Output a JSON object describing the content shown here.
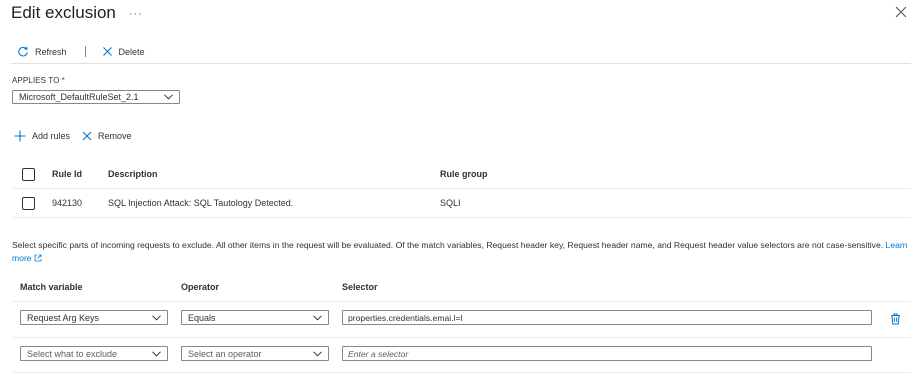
{
  "header": {
    "title": "Edit exclusion",
    "more_label": "···"
  },
  "toolbar": {
    "refresh_label": "Refresh",
    "delete_label": "Delete"
  },
  "applies_to": {
    "label": "APPLIES TO",
    "required_mark": "*",
    "selected": "Microsoft_DefaultRuleSet_2.1"
  },
  "rules_bar": {
    "add_label": "Add rules",
    "remove_label": "Remove"
  },
  "rules_table": {
    "columns": [
      "Rule Id",
      "Description",
      "Rule group"
    ],
    "rows": [
      {
        "rule_id": "942130",
        "description": "SQL Injection Attack: SQL Tautology Detected.",
        "rule_group": "SQLI"
      }
    ]
  },
  "info": {
    "text": "Select specific parts of incoming requests to exclude. All other items in the request will be evaluated. Of the match variables, Request header key, Request header name, and Request header value selectors are not case-sensitive.",
    "learn_more_label": "Learn more"
  },
  "exclusions": {
    "columns": [
      "Match variable",
      "Operator",
      "Selector"
    ],
    "rows": [
      {
        "match_variable": "Request Arg Keys",
        "operator": "Equals",
        "selector": "properties.credentials.emai.l=l"
      }
    ],
    "new_row": {
      "match_variable_placeholder": "Select what to exclude",
      "operator_placeholder": "Select an operator",
      "selector_placeholder": "Enter a selector"
    }
  },
  "colors": {
    "accent": "#0078d4",
    "required": "#a4262c",
    "border": "#8a8886",
    "divider": "#edebe9"
  },
  "icons": [
    "refresh-icon",
    "delete-icon",
    "close-icon",
    "add-icon",
    "remove-icon",
    "chevron-down-icon",
    "external-link-icon",
    "trash-icon"
  ]
}
